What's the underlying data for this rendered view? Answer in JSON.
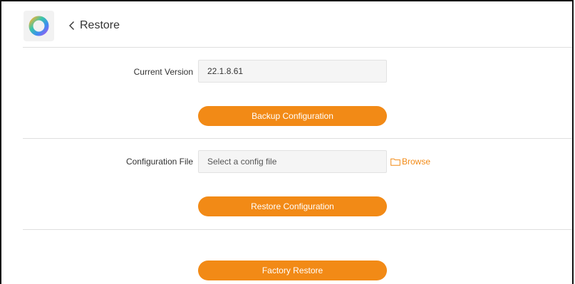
{
  "header": {
    "back_label": "Restore",
    "logo_icon": "ring-logo-icon",
    "back_icon": "chevron-left-icon"
  },
  "version": {
    "label": "Current Version",
    "value": "22.1.8.61"
  },
  "backup": {
    "button_label": "Backup Configuration"
  },
  "config_file": {
    "label": "Configuration File",
    "placeholder": "Select a config file",
    "browse_label": "Browse",
    "browse_icon": "folder-icon"
  },
  "restore": {
    "button_label": "Restore Configuration"
  },
  "factory": {
    "button_label": "Factory Restore"
  },
  "colors": {
    "accent": "#f28a16",
    "field_bg": "#f5f5f5",
    "divider": "#dedede"
  }
}
